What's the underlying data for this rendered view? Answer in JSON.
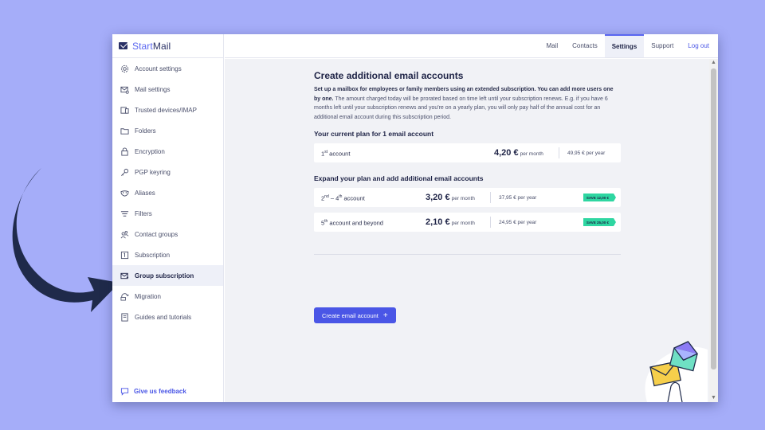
{
  "brand": {
    "name_part1": "Start",
    "name_part2": "Mail"
  },
  "sidebar": {
    "items": [
      {
        "label": "Account settings",
        "icon": "gear-icon"
      },
      {
        "label": "Mail settings",
        "icon": "mail-settings-icon"
      },
      {
        "label": "Trusted devices/IMAP",
        "icon": "devices-icon"
      },
      {
        "label": "Folders",
        "icon": "folder-icon"
      },
      {
        "label": "Encryption",
        "icon": "lock-icon"
      },
      {
        "label": "PGP keyring",
        "icon": "key-icon"
      },
      {
        "label": "Aliases",
        "icon": "mask-icon"
      },
      {
        "label": "Filters",
        "icon": "filter-icon"
      },
      {
        "label": "Contact groups",
        "icon": "contact-groups-icon"
      },
      {
        "label": "Subscription",
        "icon": "subscription-icon"
      },
      {
        "label": "Group subscription",
        "icon": "group-subscription-icon",
        "active": true
      },
      {
        "label": "Migration",
        "icon": "migration-icon"
      },
      {
        "label": "Guides and tutorials",
        "icon": "guide-icon"
      }
    ],
    "feedback": "Give us feedback"
  },
  "topnav": {
    "mail": "Mail",
    "contacts": "Contacts",
    "settings": "Settings",
    "support": "Support",
    "logout": "Log out",
    "active": "Settings"
  },
  "content": {
    "title": "Create additional email accounts",
    "desc_bold": "Set up a mailbox for employees or family members using an extended subscription. You can add more users one by one.",
    "desc_rest": " The amount charged today will be prorated based on time left until your subscription renews. E.g. if you have 6 months left until your subscription renews and you're on a yearly plan, you will only pay half of the annual cost for an additional email account during this subscription period.",
    "current_plan_heading": "Your current plan for 1 email account",
    "current_plan": {
      "num": "1",
      "sup": "st",
      "label": " account",
      "price": "4,20 €",
      "unit": "per month",
      "year": "49,95 € per year"
    },
    "expand_heading": "Expand your plan and add additional email accounts",
    "expand_rows": [
      {
        "num_a": "2",
        "sup_a": "nd",
        "mid": " – 4",
        "sup_b": "th",
        "label": " account",
        "price": "3,20 €",
        "unit": "per month",
        "year": "37,95 € per year",
        "save": "SAVE 12,00 €"
      },
      {
        "num_a": "5",
        "sup_a": "th",
        "label": " account and beyond",
        "price": "2,10 €",
        "unit": "per month",
        "year": "24,95 € per year",
        "save": "SAVE 25,00 €"
      }
    ],
    "create_button": "Create email account",
    "create_plus": "+"
  },
  "colors": {
    "background": "#a5adf9",
    "accent": "#4a56e6",
    "save_badge": "#2ed6a1",
    "arrow": "#1f2a4a"
  }
}
